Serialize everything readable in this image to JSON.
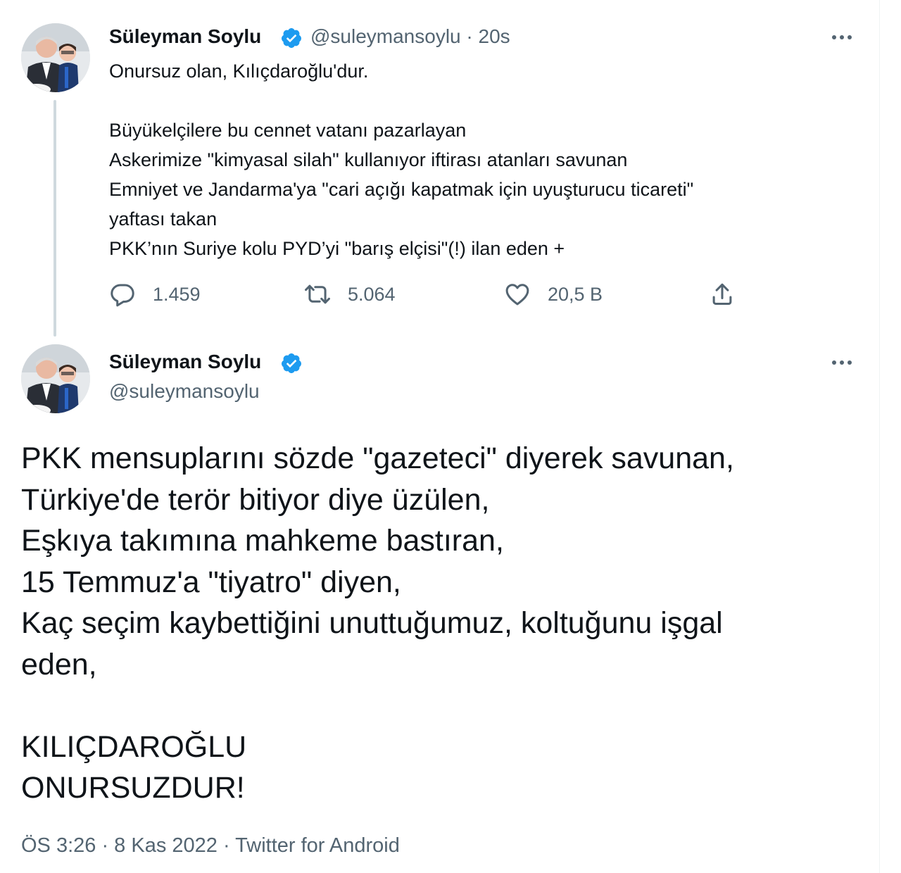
{
  "tweet1": {
    "author_name": "Süleyman Soylu",
    "handle_time": "@suleymansoylu · 20s",
    "text": "Onursuz olan, Kılıçdaroğlu'dur.\n\nBüyükelçilere bu cennet vatanı pazarlayan\nAskerimize \"kimyasal silah\" kullanıyor iftirası atanları savunan\nEmniyet ve Jandarma'ya \"cari açığı kapatmak için uyuşturucu ticareti\"\nyaftası takan\nPKK’nın Suriye kolu PYD’yi \"barış elçisi\"(!) ilan eden +",
    "replies": "1.459",
    "retweets": "5.064",
    "likes": "20,5 B",
    "icons": [
      "verified-badge-icon",
      "more-options-icon",
      "reply-icon",
      "retweet-icon",
      "like-icon",
      "share-icon"
    ]
  },
  "tweet2": {
    "author_name": "Süleyman Soylu",
    "handle": "@suleymansoylu",
    "text": "PKK mensuplarını sözde \"gazeteci\" diyerek savunan,\nTürkiye'de terör bitiyor diye üzülen,\nEşkıya takımına mahkeme bastıran,\n15 Temmuz'a \"tiyatro\" diyen,\nKaç seçim kaybettiğini unuttuğumuz, koltuğunu işgal\neden,\n\nKILIÇDAROĞLU\nONURSUZDUR!",
    "meta": "ÖS 3:26 · 8 Kas 2022 · Twitter for Android"
  },
  "colors": {
    "text_primary": "#0f1419",
    "text_secondary": "#536471",
    "verified_blue": "#1d9bf0",
    "thread_line": "#cfd9de"
  }
}
